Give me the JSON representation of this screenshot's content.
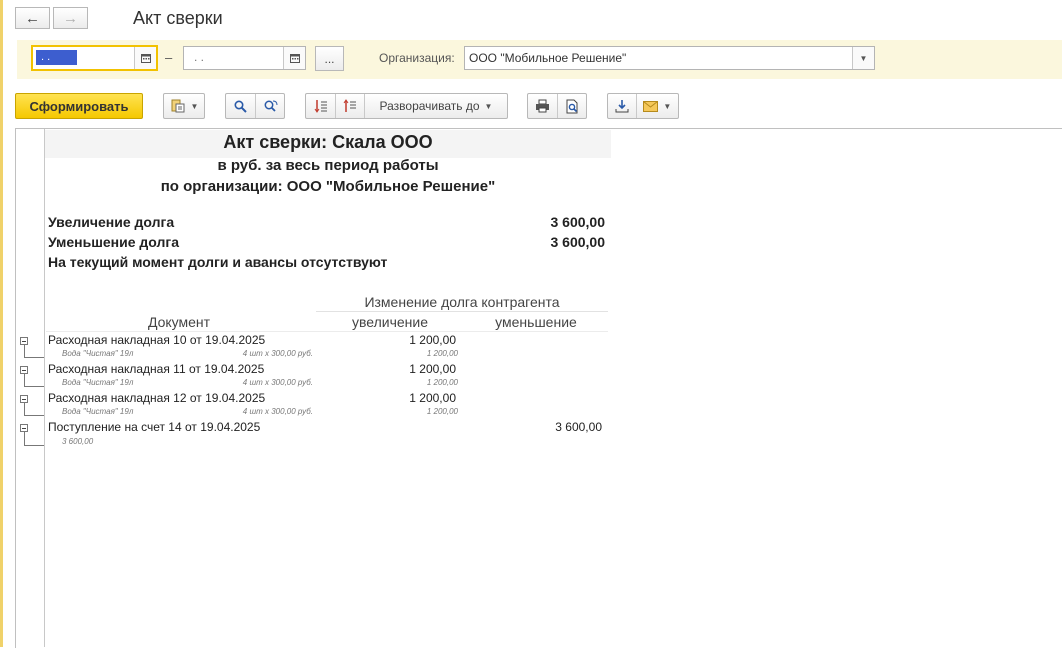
{
  "header": {
    "title": "Акт сверки",
    "back_icon": "←",
    "forward_icon": "→"
  },
  "filter": {
    "date_from_value": ". .",
    "date_separator": "–",
    "date_to_value": ". .",
    "period_button_label": "...",
    "org_label": "Организация:",
    "org_value": "ООО \"Мобильное Решение\""
  },
  "toolbar": {
    "generate_label": "Сформировать",
    "expand_label": "Разворачивать до"
  },
  "report": {
    "title": "Акт сверки: Скала ООО",
    "subtitle1": "в руб. за весь период работы",
    "subtitle2": "по организации: ООО \"Мобильное Решение\"",
    "summary": [
      {
        "label": "Увеличение долга",
        "value": "3 600,00"
      },
      {
        "label": "Уменьшение долга",
        "value": "3 600,00"
      }
    ],
    "status_line": "На текущий момент долги и авансы отсутствуют",
    "columns": {
      "group_header": "Изменение долга контрагента",
      "document": "Документ",
      "increase": "увеличение",
      "decrease": "уменьшение"
    },
    "rows": [
      {
        "doc": "Расходная накладная 10 от 19.04.2025",
        "increase": "1 200,00",
        "decrease": "",
        "sub_item": "Вода \"Чистая\" 19л",
        "sub_qty": "4 шт x 300,00 руб.",
        "sub_sum": "1 200,00"
      },
      {
        "doc": "Расходная накладная 11 от 19.04.2025",
        "increase": "1 200,00",
        "decrease": "",
        "sub_item": "Вода \"Чистая\" 19л",
        "sub_qty": "4 шт x 300,00 руб.",
        "sub_sum": "1 200,00"
      },
      {
        "doc": "Расходная накладная 12 от 19.04.2025",
        "increase": "1 200,00",
        "decrease": "",
        "sub_item": "Вода \"Чистая\" 19л",
        "sub_qty": "4 шт x 300,00 руб.",
        "sub_sum": "1 200,00"
      },
      {
        "doc": "Поступление на счет 14 от 19.04.2025",
        "increase": "",
        "decrease": "3 600,00",
        "sub_item": "3 600,00",
        "sub_qty": "",
        "sub_sum": ""
      }
    ]
  }
}
